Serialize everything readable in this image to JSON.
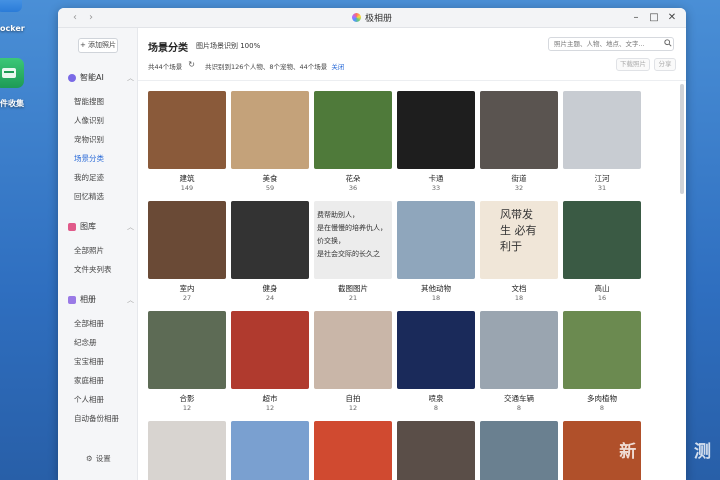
{
  "desktop": {
    "icon1_label": "ocker",
    "icon2_label": "件收集"
  },
  "window": {
    "title": "极相册"
  },
  "sidebar": {
    "add_photo": "+ 添加照片",
    "sections": [
      {
        "label": "智能AI",
        "items": [
          "智能搜图",
          "人像识别",
          "宠物识别",
          "场景分类",
          "我的足迹",
          "回忆精选"
        ]
      },
      {
        "label": "图库",
        "items": [
          "全部照片",
          "文件夹列表"
        ]
      },
      {
        "label": "相册",
        "items": [
          "全部相册",
          "纪念册",
          "宝宝相册",
          "家庭相册",
          "个人相册",
          "自动备份相册"
        ]
      }
    ],
    "active": "场景分类",
    "settings": "设置"
  },
  "main": {
    "title": "场景分类",
    "sub": "图片场景识别 100%",
    "search_placeholder": "照片主题、人物、地点、文字...",
    "info_count": "共44个场景",
    "info_desc": "共识别到126个人物、8个宠物、44个场景",
    "info_close": "关闭",
    "btn_download": "下载照片",
    "btn_share": "分享"
  },
  "scenes": [
    {
      "name": "建筑",
      "count": "149",
      "color": "#8a5a3a"
    },
    {
      "name": "美食",
      "count": "59",
      "color": "#c4a27a"
    },
    {
      "name": "花朵",
      "count": "36",
      "color": "#4f7a3a"
    },
    {
      "name": "卡通",
      "count": "33",
      "color": "#1e1e1e"
    },
    {
      "name": "街道",
      "count": "32",
      "color": "#5a5450"
    },
    {
      "name": "江河",
      "count": "31",
      "color": "#c8ccd2"
    },
    {
      "name": "室内",
      "count": "27",
      "color": "#6a4a36"
    },
    {
      "name": "健身",
      "count": "24",
      "color": "#333333"
    },
    {
      "name": "截图图片",
      "count": "21",
      "color": "#ececec"
    },
    {
      "name": "其他动物",
      "count": "18",
      "color": "#8fa6bc"
    },
    {
      "name": "文档",
      "count": "18",
      "color": "#f0e6d8"
    },
    {
      "name": "高山",
      "count": "16",
      "color": "#3a5a44"
    },
    {
      "name": "合影",
      "count": "12",
      "color": "#5d6b55"
    },
    {
      "name": "超市",
      "count": "12",
      "color": "#b03a2e"
    },
    {
      "name": "自拍",
      "count": "12",
      "color": "#c9b6a8"
    },
    {
      "name": "喷泉",
      "count": "8",
      "color": "#1a2a5a"
    },
    {
      "name": "交通车辆",
      "count": "8",
      "color": "#9aa5b0"
    },
    {
      "name": "多肉植物",
      "count": "8",
      "color": "#6b8a50"
    },
    {
      "name": "",
      "count": "",
      "color": "#d8d4d0"
    },
    {
      "name": "",
      "count": "",
      "color": "#7aa0d0"
    },
    {
      "name": "",
      "count": "",
      "color": "#d04a30"
    },
    {
      "name": "",
      "count": "",
      "color": "#5a4e48"
    },
    {
      "name": "",
      "count": "",
      "color": "#6a8090"
    },
    {
      "name": "",
      "count": "",
      "color": "#b0502a"
    }
  ],
  "screenshot_text": [
    "费帮助别人，",
    "是在慢慢的培养仇人，",
    "价交换，",
    "是社会交际的长久之"
  ],
  "doc_text": "风带发生 必有利于",
  "watermark": "新 浪 众 测"
}
